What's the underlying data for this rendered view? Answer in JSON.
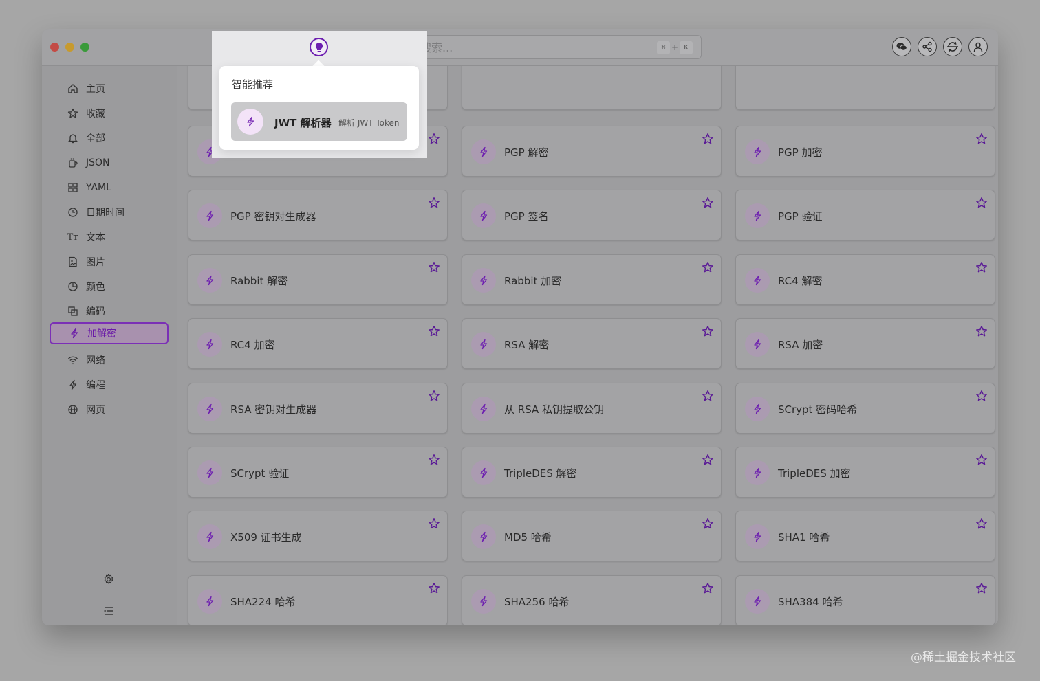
{
  "window": {
    "traffic_lights": [
      "close",
      "minimize",
      "zoom"
    ]
  },
  "search": {
    "placeholder": "输入关键字搜索...",
    "shortcut_key1": "⌘",
    "shortcut_plus": "+",
    "shortcut_key2": "K"
  },
  "toolbar": {
    "buttons": [
      "wechat-icon",
      "share-icon",
      "sync-icon",
      "user-icon"
    ]
  },
  "sidebar": {
    "items": [
      {
        "label": "主页",
        "icon": "home-icon"
      },
      {
        "label": "收藏",
        "icon": "star-icon"
      },
      {
        "label": "全部",
        "icon": "bell-icon"
      },
      {
        "label": "JSON",
        "icon": "json-icon"
      },
      {
        "label": "YAML",
        "icon": "grid-icon"
      },
      {
        "label": "日期时间",
        "icon": "clock-icon"
      },
      {
        "label": "文本",
        "icon": "text-icon",
        "glyph": "Tт"
      },
      {
        "label": "图片",
        "icon": "image-icon"
      },
      {
        "label": "颜色",
        "icon": "palette-icon"
      },
      {
        "label": "编码",
        "icon": "encode-icon"
      },
      {
        "label": "加解密",
        "icon": "bolt-icon",
        "active": true
      },
      {
        "label": "网络",
        "icon": "wifi-icon"
      },
      {
        "label": "编程",
        "icon": "code-icon"
      },
      {
        "label": "网页",
        "icon": "globe-icon"
      }
    ],
    "bottom": [
      "settings-icon",
      "collapse-menu-icon"
    ]
  },
  "cards": [
    [
      {
        "label": ""
      },
      {
        "label": "PGP 解密"
      },
      {
        "label": "PGP 加密"
      }
    ],
    [
      {
        "label": "PGP 密钥对生成器"
      },
      {
        "label": "PGP 签名"
      },
      {
        "label": "PGP 验证"
      }
    ],
    [
      {
        "label": "Rabbit 解密"
      },
      {
        "label": "Rabbit 加密"
      },
      {
        "label": "RC4 解密"
      }
    ],
    [
      {
        "label": "RC4 加密"
      },
      {
        "label": "RSA 解密"
      },
      {
        "label": "RSA 加密"
      }
    ],
    [
      {
        "label": "RSA 密钥对生成器"
      },
      {
        "label": "从 RSA 私钥提取公钥"
      },
      {
        "label": "SCrypt 密码哈希"
      }
    ],
    [
      {
        "label": "SCrypt 验证"
      },
      {
        "label": "TripleDES 解密"
      },
      {
        "label": "TripleDES 加密"
      }
    ],
    [
      {
        "label": "X509 证书生成"
      },
      {
        "label": "MD5 哈希"
      },
      {
        "label": "SHA1 哈希"
      }
    ],
    [
      {
        "label": "SHA224 哈希"
      },
      {
        "label": "SHA256 哈希"
      },
      {
        "label": "SHA384 哈希"
      }
    ]
  ],
  "popup": {
    "title": "智能推荐",
    "item_name": "JWT 解析器",
    "item_desc": "解析 JWT Token"
  },
  "watermark": "@稀土掘金技术社区",
  "colors": {
    "accent": "#6d1fb0",
    "background": "#a6a6a6"
  }
}
